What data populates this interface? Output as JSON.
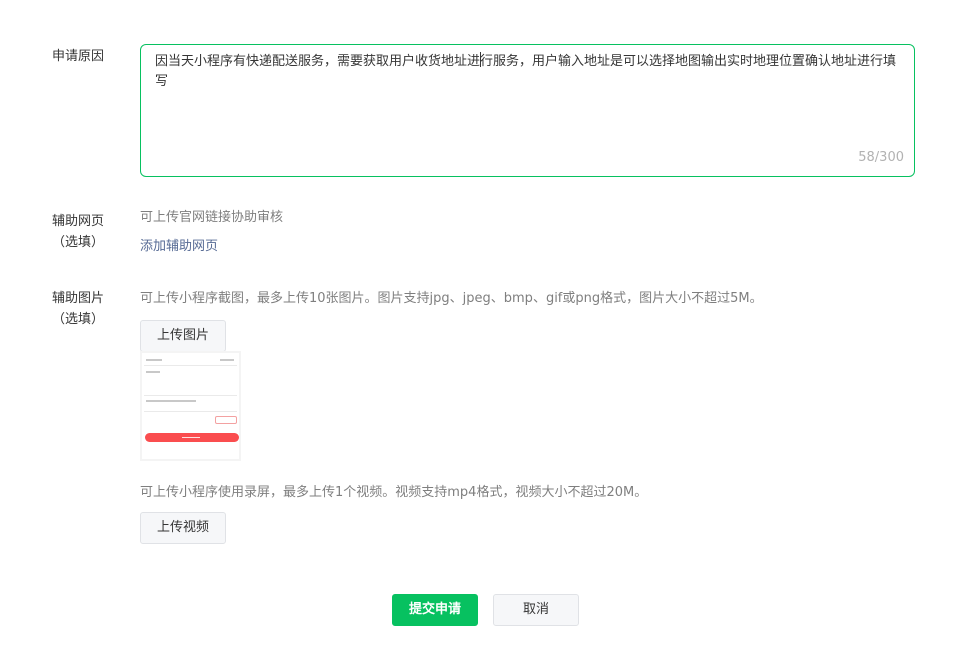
{
  "reason": {
    "label": "申请原因",
    "text_before_caret": "因当天小程序有快递配送服务，需要获取用户收货地址进",
    "text_after_caret": "行服务，用户输入地址是可以选择地图输出实时地理位置确认地址进行填写",
    "counter": "58/300"
  },
  "web": {
    "label_line1": "辅助网页",
    "label_line2": "（选填）",
    "hint": "可上传官网链接协助审核",
    "add_link": "添加辅助网页"
  },
  "images": {
    "label_line1": "辅助图片",
    "label_line2": "（选填）",
    "hint": "可上传小程序截图，最多上传10张图片。图片支持jpg、jpeg、bmp、gif或png格式，图片大小不超过5M。",
    "upload_button": "上传图片",
    "video_hint": "可上传小程序使用录屏，最多上传1个视频。视频支持mp4格式，视频大小不超过20M。",
    "upload_video_button": "上传视频"
  },
  "actions": {
    "submit": "提交申请",
    "cancel": "取消"
  },
  "colors": {
    "primary": "#07c160",
    "link": "#576b95",
    "thumb_button": "#fa4d4f"
  }
}
